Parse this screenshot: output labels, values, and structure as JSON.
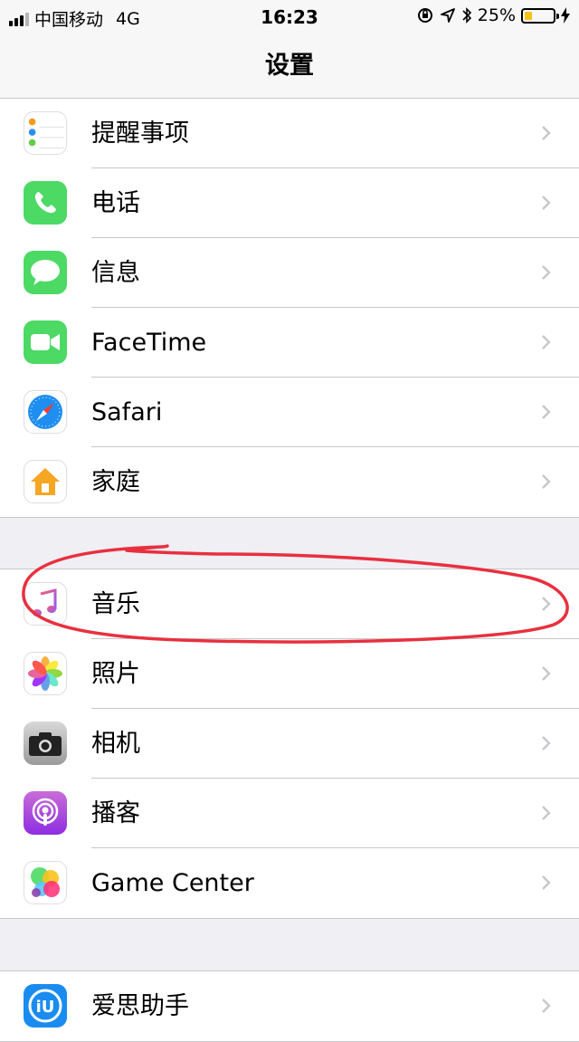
{
  "status_bar": {
    "carrier": "中国移动",
    "network": "4G",
    "time": "16:23",
    "battery": "25%",
    "battery_level": 0.25
  },
  "nav": {
    "title": "设置"
  },
  "groups": [
    {
      "rows": [
        {
          "label": "提醒事项",
          "icon": "reminders-icon"
        },
        {
          "label": "电话",
          "icon": "phone-icon"
        },
        {
          "label": "信息",
          "icon": "messages-icon"
        },
        {
          "label": "FaceTime",
          "icon": "facetime-icon"
        },
        {
          "label": "Safari",
          "icon": "safari-icon"
        },
        {
          "label": "家庭",
          "icon": "home-icon"
        }
      ]
    },
    {
      "rows": [
        {
          "label": "音乐",
          "icon": "music-icon"
        },
        {
          "label": "照片",
          "icon": "photos-icon"
        },
        {
          "label": "相机",
          "icon": "camera-icon"
        },
        {
          "label": "播客",
          "icon": "podcasts-icon"
        },
        {
          "label": "Game Center",
          "icon": "game-center-icon"
        }
      ]
    },
    {
      "rows": [
        {
          "label": "爱思助手",
          "icon": "aisi-icon"
        }
      ]
    }
  ],
  "colors": {
    "background": "#efeff4",
    "annotation": "#e8303f",
    "chevron": "#c7c7cc"
  }
}
